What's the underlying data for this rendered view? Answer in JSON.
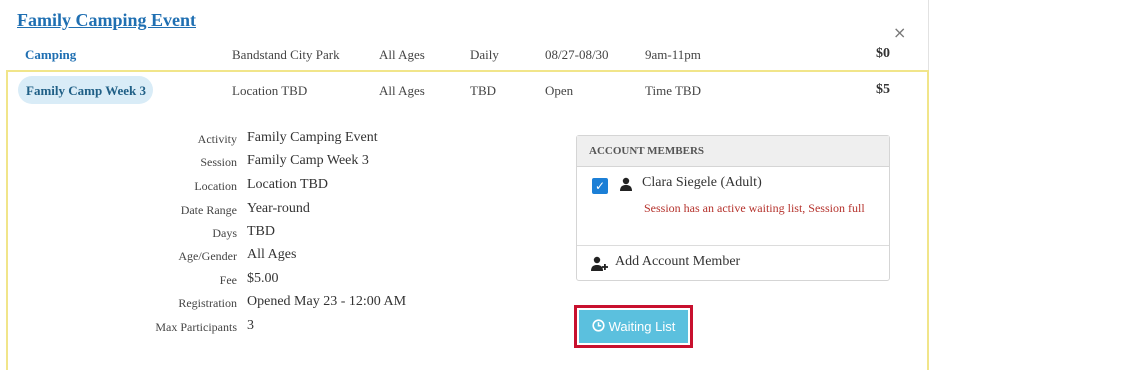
{
  "event": {
    "title": "Family Camping Event",
    "close_glyph": "×"
  },
  "sessions": [
    {
      "name": "Camping",
      "location": "Bandstand City Park",
      "ages": "All Ages",
      "days": "Daily",
      "dates": "08/27-08/30",
      "time": "9am-11pm",
      "price": "$0"
    },
    {
      "name": "Family Camp Week 3",
      "location": "Location TBD",
      "ages": "All Ages",
      "days": "TBD",
      "dates": "Open",
      "time": "Time TBD",
      "price": "$5"
    }
  ],
  "details": [
    {
      "label": "Activity",
      "value": "Family Camping Event"
    },
    {
      "label": "Session",
      "value": "Family Camp Week 3"
    },
    {
      "label": "Location",
      "value": "Location TBD"
    },
    {
      "label": "Date Range",
      "value": "Year-round"
    },
    {
      "label": "Days",
      "value": "TBD"
    },
    {
      "label": "Age/Gender",
      "value": "All Ages"
    },
    {
      "label": "Fee",
      "value": "$5.00"
    },
    {
      "label": "Registration",
      "value": "Opened May 23 - 12:00 AM"
    },
    {
      "label": "Max Participants",
      "value": "3"
    }
  ],
  "members": {
    "header": "ACCOUNT MEMBERS",
    "member": {
      "name": "Clara Siegele (Adult)",
      "checked": true,
      "warning": "Session has an active waiting list, Session full"
    },
    "add_label": "Add Account Member"
  },
  "waiting_list": {
    "label": "Waiting List",
    "color": "#5bc0de",
    "highlight": "#c8102e"
  },
  "colors": {
    "link": "#1f6fb2",
    "selected_border": "#f1e58a",
    "pill": "#d9ecf7",
    "warning": "#b5322c"
  },
  "icons": [
    "close-icon",
    "user-icon",
    "add-user-icon",
    "clock-icon",
    "checkmark-icon"
  ]
}
